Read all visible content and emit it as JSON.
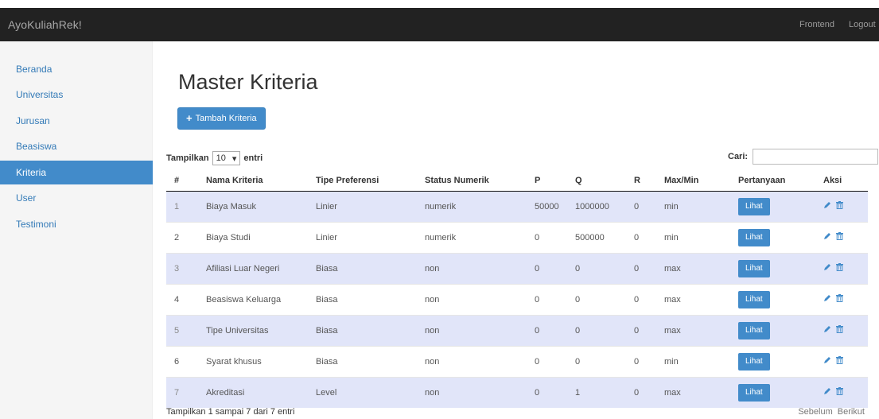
{
  "navbar": {
    "brand": "AyoKuliahRek!",
    "links": [
      "Frontend",
      "Logout"
    ]
  },
  "sidebar": {
    "items": [
      {
        "label": "Beranda",
        "active": false
      },
      {
        "label": "Universitas",
        "active": false
      },
      {
        "label": "Jurusan",
        "active": false
      },
      {
        "label": "Beasiswa",
        "active": false
      },
      {
        "label": "Kriteria",
        "active": true
      },
      {
        "label": "User",
        "active": false
      },
      {
        "label": "Testimoni",
        "active": false
      }
    ]
  },
  "main": {
    "title": "Master Kriteria",
    "add_button": "Tambah Kriteria",
    "length_prefix": "Tampilkan",
    "length_value": "10",
    "length_suffix": "entri",
    "search_label": "Cari:",
    "search_value": "",
    "columns": [
      "#",
      "Nama Kriteria",
      "Tipe Preferensi",
      "Status Numerik",
      "P",
      "Q",
      "R",
      "Max/Min",
      "Pertanyaan",
      "Aksi"
    ],
    "rows": [
      [
        "1",
        "Biaya Masuk",
        "Linier",
        "numerik",
        "50000",
        "1000000",
        "0",
        "min"
      ],
      [
        "2",
        "Biaya Studi",
        "Linier",
        "numerik",
        "0",
        "500000",
        "0",
        "min"
      ],
      [
        "3",
        "Afiliasi Luar Negeri",
        "Biasa",
        "non",
        "0",
        "0",
        "0",
        "max"
      ],
      [
        "4",
        "Beasiswa Keluarga",
        "Biasa",
        "non",
        "0",
        "0",
        "0",
        "max"
      ],
      [
        "5",
        "Tipe Universitas",
        "Biasa",
        "non",
        "0",
        "0",
        "0",
        "max"
      ],
      [
        "6",
        "Syarat khusus",
        "Biasa",
        "non",
        "0",
        "0",
        "0",
        "min"
      ],
      [
        "7",
        "Akreditasi",
        "Level",
        "non",
        "0",
        "1",
        "0",
        "max"
      ]
    ],
    "view_button": "Lihat",
    "info": "Tampilkan 1 sampai 7 dari 7 entri",
    "prev": "Sebelum",
    "next": "Berikut"
  },
  "colors": {
    "navbar": "#222222",
    "primary": "#428bca",
    "stripe": "#e1e5f9"
  }
}
